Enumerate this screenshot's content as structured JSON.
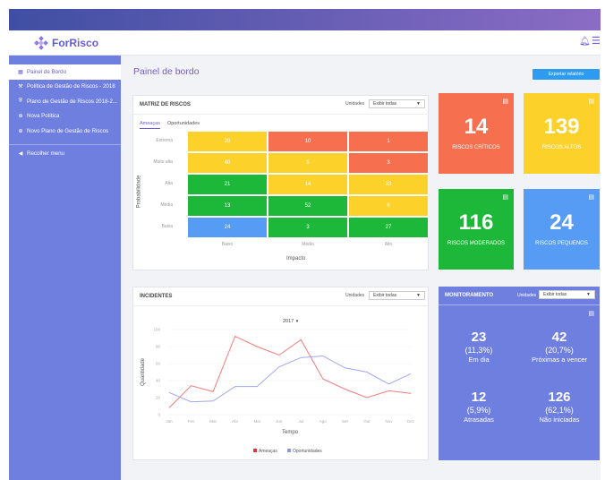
{
  "app": {
    "name_part1": "For",
    "name_part2": "Risco"
  },
  "header": {
    "bell_icon": "bell-icon",
    "menu_icon": "hamburger-icon"
  },
  "sidebar": {
    "items": [
      {
        "label": "Painel de Bordo",
        "icon": "dashboard-icon"
      },
      {
        "label": "Política de Gestão de Riscos - 2018",
        "icon": "gavel-icon"
      },
      {
        "label": "Plano de Gestão de Riscos 2018-2...",
        "icon": "shield-icon"
      },
      {
        "label": "Nova Política",
        "icon": "plus-circle-icon"
      },
      {
        "label": "Novo Plano de Gestão de Riscos",
        "icon": "plus-circle-icon"
      }
    ],
    "collapse_label": "Recolher menu"
  },
  "main": {
    "title": "Painel de bordo",
    "export_label": "Exportar relatório"
  },
  "matriz": {
    "title": "MATRIZ DE RISCOS",
    "unidades_label": "Unidades",
    "select_value": "Exibir todas",
    "tabs": [
      "Ameaças",
      "Oportunidades"
    ],
    "row_labels": [
      "Extrema",
      "Muito alta",
      "Alta",
      "Média",
      "Baixa"
    ],
    "col_labels": [
      "Baixo",
      "Médio",
      "Alto"
    ],
    "y_title": "Probabilidade",
    "x_title": "Impacto",
    "cells": [
      [
        "20",
        "10",
        "1"
      ],
      [
        "40",
        "5",
        "3"
      ],
      [
        "21",
        "14",
        "33"
      ],
      [
        "13",
        "52",
        "6"
      ],
      [
        "24",
        "3",
        "27"
      ]
    ],
    "colors": {
      "yellow": "#fcd12a",
      "orange": "#f6704f",
      "green": "#1db839",
      "blue": "#569bf4"
    }
  },
  "stats": [
    {
      "value": "14",
      "label": "RISCOS CRÍTICOS",
      "color": "#f6704f"
    },
    {
      "value": "139",
      "label": "RISCOS ALTOS",
      "color": "#fcd12a"
    },
    {
      "value": "116",
      "label": "RISCOS MODERADOS",
      "color": "#1db839"
    },
    {
      "value": "24",
      "label": "RISCOS PEQUENOS",
      "color": "#569bf4"
    }
  ],
  "incidentes": {
    "title": "INCIDENTES",
    "unidades_label": "Unidades",
    "select_value": "Exibir todas",
    "year": "2017"
  },
  "monitoramento": {
    "title": "MONITORAMENTO",
    "unidades_label": "Unidades",
    "select_value": "Exibir todas",
    "cells": [
      {
        "n": "23",
        "p": "(11,3%)",
        "l": "Em dia"
      },
      {
        "n": "42",
        "p": "(20,7%)",
        "l": "Próximas a vencer"
      },
      {
        "n": "12",
        "p": "(5,9%)",
        "l": "Atrasadas"
      },
      {
        "n": "126",
        "p": "(62,1%)",
        "l": "Não iniciadas"
      }
    ]
  },
  "chart_data": {
    "type": "line",
    "title": "",
    "xlabel": "Tempo",
    "ylabel": "Quantidade",
    "categories": [
      "Jan",
      "Fev",
      "Mar",
      "Abr",
      "Mai",
      "Jun",
      "Jul",
      "Ago",
      "Set",
      "Out",
      "Nov",
      "Dez"
    ],
    "ylim": [
      0,
      100
    ],
    "yticks": [
      "0",
      "20",
      "40",
      "60",
      "80",
      "100"
    ],
    "series": [
      {
        "name": "Ameaças",
        "color": "#f47a7a",
        "values": [
          8,
          34,
          27,
          92,
          80,
          70,
          88,
          42,
          30,
          20,
          28,
          25
        ]
      },
      {
        "name": "Oportunidades",
        "color": "#9ea8ee",
        "values": [
          26,
          15,
          16,
          33,
          33,
          56,
          67,
          69,
          55,
          50,
          36,
          48
        ]
      }
    ],
    "legend": "bottom"
  }
}
